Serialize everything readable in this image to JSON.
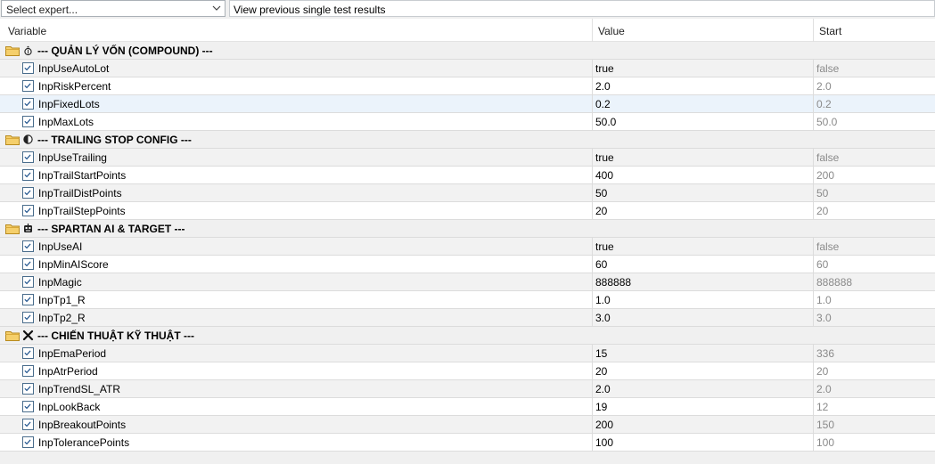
{
  "toolbar": {
    "expert_select_placeholder": "Select expert...",
    "previous_results_label": "View previous single test results"
  },
  "columns": {
    "variable": "Variable",
    "value": "Value",
    "start": "Start"
  },
  "groups": [
    {
      "title": "--- QUẢN LÝ VỐN (COMPOUND) ---",
      "icon": "money-bag-icon",
      "params": [
        {
          "name": "InpUseAutoLot",
          "value": "true",
          "start": "false"
        },
        {
          "name": "InpRiskPercent",
          "value": "2.0",
          "start": "2.0"
        },
        {
          "name": "InpFixedLots",
          "value": "0.2",
          "start": "0.2"
        },
        {
          "name": "InpMaxLots",
          "value": "50.0",
          "start": "50.0"
        }
      ]
    },
    {
      "title": "--- TRAILING STOP CONFIG ---",
      "icon": "half-circle-icon",
      "params": [
        {
          "name": "InpUseTrailing",
          "value": "true",
          "start": "false"
        },
        {
          "name": "InpTrailStartPoints",
          "value": "400",
          "start": "200"
        },
        {
          "name": "InpTrailDistPoints",
          "value": "50",
          "start": "50"
        },
        {
          "name": "InpTrailStepPoints",
          "value": "20",
          "start": "20"
        }
      ]
    },
    {
      "title": "--- SPARTAN AI & TARGET ---",
      "icon": "robot-icon",
      "params": [
        {
          "name": "InpUseAI",
          "value": "true",
          "start": "false"
        },
        {
          "name": "InpMinAIScore",
          "value": "60",
          "start": "60"
        },
        {
          "name": "InpMagic",
          "value": "888888",
          "start": "888888"
        },
        {
          "name": "InpTp1_R",
          "value": "1.0",
          "start": "1.0"
        },
        {
          "name": "InpTp2_R",
          "value": "3.0",
          "start": "3.0"
        }
      ]
    },
    {
      "title": "--- CHIẾN THUẬT KỸ THUẬT ---",
      "icon": "crossed-swords-icon",
      "params": [
        {
          "name": "InpEmaPeriod",
          "value": "15",
          "start": "336"
        },
        {
          "name": "InpAtrPeriod",
          "value": "20",
          "start": "20"
        },
        {
          "name": "InpTrendSL_ATR",
          "value": "2.0",
          "start": "2.0"
        },
        {
          "name": "InpLookBack",
          "value": "19",
          "start": "12"
        },
        {
          "name": "InpBreakoutPoints",
          "value": "200",
          "start": "150"
        },
        {
          "name": "InpTolerancePoints",
          "value": "100",
          "start": "100"
        }
      ]
    }
  ],
  "colors": {
    "folder": "#e8b84a",
    "selected_row": "#ebf3fb",
    "alt_row": "#f2f2f2",
    "checkbox_border": "#4a6d8c"
  }
}
